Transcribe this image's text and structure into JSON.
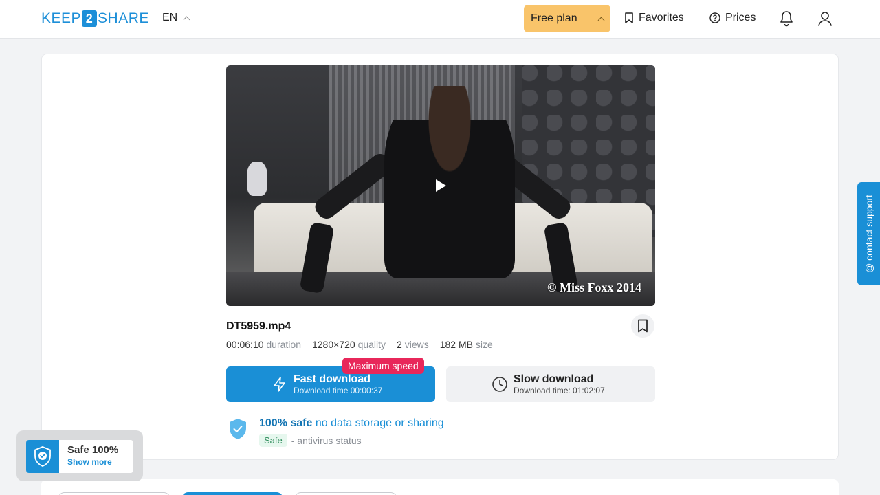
{
  "header": {
    "logo_left": "KEEP",
    "logo_mid": "2",
    "logo_right": "SHARE",
    "language": "EN",
    "plan_label": "Free plan",
    "favorites_label": "Favorites",
    "prices_label": "Prices",
    "icons": {
      "favorites": "bookmark-icon",
      "prices": "question-circle-icon",
      "notifications": "bell-icon",
      "account": "user-icon"
    }
  },
  "file": {
    "name": "DT5959.mp4",
    "watermark": "© Miss Foxx 2014",
    "duration_value": "00:06:10",
    "duration_label": "duration",
    "quality_value": "1280×720",
    "quality_label": "quality",
    "views_value": "2",
    "views_label": "views",
    "size_value": "182 MB",
    "size_label": "size"
  },
  "download": {
    "fast_title": "Fast download",
    "fast_sub": "Download time 00:00:37",
    "fast_badge": "Maximum speed",
    "slow_title": "Slow download",
    "slow_sub": "Download time: 01:02:07"
  },
  "safety": {
    "title_bold": "100% safe",
    "title_rest": "no data storage or sharing",
    "tag": "Safe",
    "status_text": "- antivirus status"
  },
  "support": {
    "label": "@ contact support"
  },
  "safe_widget": {
    "title": "Safe 100%",
    "link": "Show more"
  },
  "colors": {
    "brand": "#1a8fd6",
    "plan": "#f9c46a",
    "badge": "#e8275a",
    "safe_tag_bg": "#e6f7ee"
  }
}
